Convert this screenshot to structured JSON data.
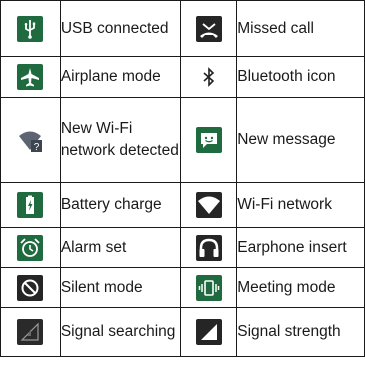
{
  "rows": [
    {
      "left": {
        "icon": "usb-icon",
        "label": "USB connected",
        "bg": "#1f6b3f"
      },
      "right": {
        "icon": "missed-call-icon",
        "label": "Missed call",
        "bg": "#252525"
      }
    },
    {
      "left": {
        "icon": "airplane-icon",
        "label": "Airplane mode",
        "bg": "#1f6b3f"
      },
      "right": {
        "icon": "bluetooth-icon",
        "label": "Bluetooth icon",
        "bg": "#ffffff"
      }
    },
    {
      "left": {
        "icon": "new-wifi-icon",
        "label": "New Wi-Fi network detected",
        "bg": "#ffffff"
      },
      "right": {
        "icon": "new-message-icon",
        "label": "New message",
        "bg": "#1f6b3f"
      }
    },
    {
      "left": {
        "icon": "battery-charge-icon",
        "label": "Battery charge",
        "bg": "#1f6b3f"
      },
      "right": {
        "icon": "wifi-icon",
        "label": "Wi-Fi network",
        "bg": "#252525"
      }
    },
    {
      "left": {
        "icon": "alarm-icon",
        "label": "Alarm set",
        "bg": "#1f6b3f"
      },
      "right": {
        "icon": "earphone-icon",
        "label": "Earphone insert",
        "bg": "#252525"
      }
    },
    {
      "left": {
        "icon": "silent-mode-icon",
        "label": "Silent mode",
        "bg": "#252525"
      },
      "right": {
        "icon": "meeting-mode-icon",
        "label": "Meeting mode",
        "bg": "#1f6b3f"
      }
    },
    {
      "left": {
        "icon": "signal-searching-icon",
        "label": "Signal searching",
        "bg": "#2a2a2a"
      },
      "right": {
        "icon": "signal-strength-icon",
        "label": "Signal strength",
        "bg": "#252525"
      }
    }
  ]
}
